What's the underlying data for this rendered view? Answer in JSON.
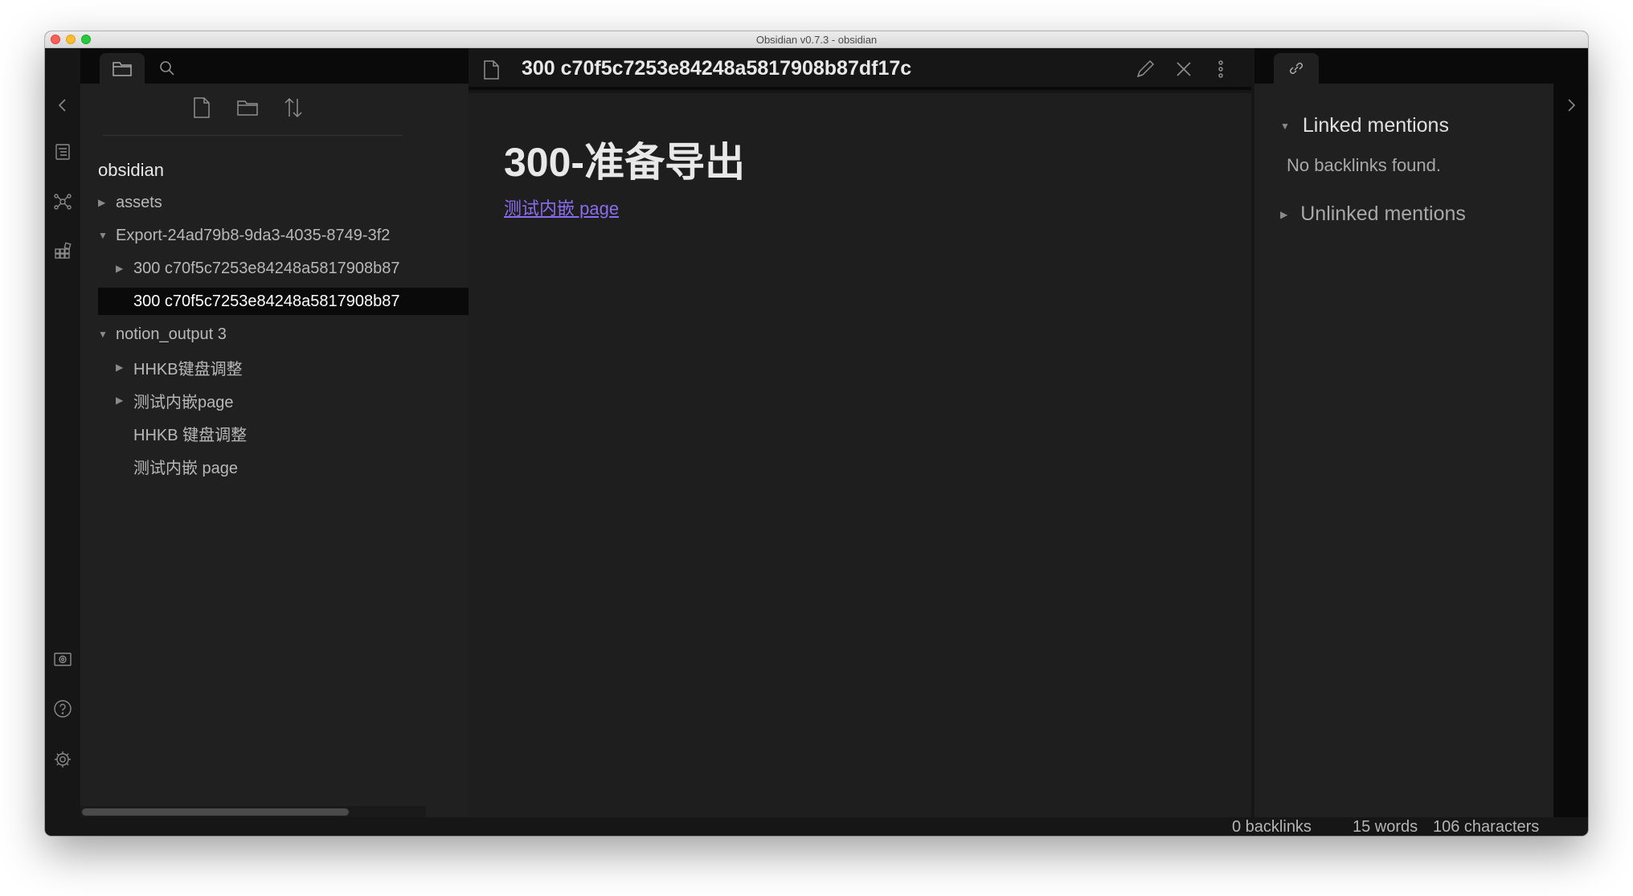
{
  "window": {
    "title": "Obsidian v0.7.3 - obsidian"
  },
  "explorer": {
    "vault_name": "obsidian",
    "tree": [
      {
        "label": "assets",
        "arrow": "▶"
      },
      {
        "label": "Export-24ad79b8-9da3-4035-8749-3f2",
        "arrow": "▼"
      },
      {
        "label": "300 c70f5c7253e84248a5817908b87",
        "arrow": "▶"
      },
      {
        "label": "300 c70f5c7253e84248a5817908b87",
        "arrow": ""
      },
      {
        "label": "notion_output 3",
        "arrow": "▼"
      },
      {
        "label": "HHKB键盘调整",
        "arrow": "▶"
      },
      {
        "label": "测试内嵌page",
        "arrow": "▶"
      },
      {
        "label": "HHKB 键盘调整",
        "arrow": ""
      },
      {
        "label": "测试内嵌 page",
        "arrow": ""
      }
    ]
  },
  "editor": {
    "tab_title": "300 c70f5c7253e84248a5817908b87df17c",
    "heading": "300-准备导出",
    "link_text": "测试内嵌 page"
  },
  "backlinks": {
    "linked_label": "Linked mentions",
    "linked_arrow": "▼",
    "no_backlinks": "No backlinks found.",
    "unlinked_label": "Unlinked mentions",
    "unlinked_arrow": "▶"
  },
  "status": {
    "backlinks": "0 backlinks",
    "words": "15 words",
    "characters": "106 characters"
  },
  "icons": {
    "ribbon_top": [
      "chevron-left-icon",
      "outline-icon",
      "graph-icon",
      "grid-icon"
    ],
    "ribbon_bottom": [
      "vault-icon",
      "help-icon",
      "settings-icon"
    ],
    "explorer_toolbar": [
      "new-file-icon",
      "new-folder-icon",
      "sort-icon"
    ]
  },
  "colors": {
    "link": "#8b6cef",
    "selected_row": "#0a0a0a",
    "editor_bg": "#1e1e1e"
  }
}
